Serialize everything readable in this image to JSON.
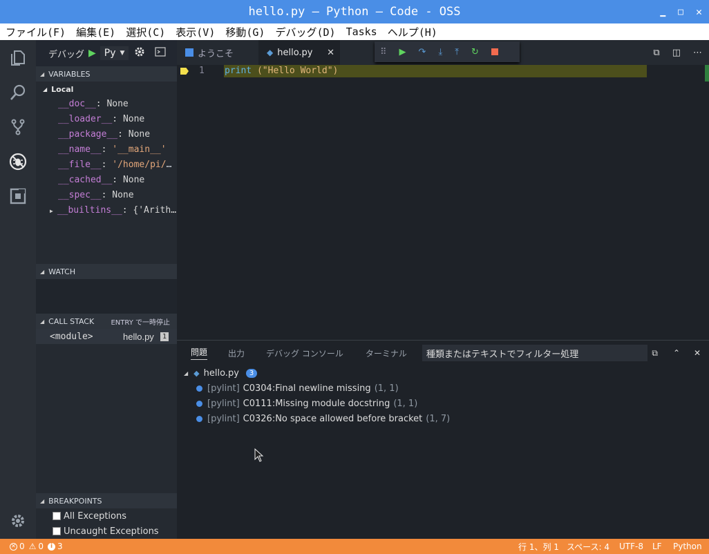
{
  "window": {
    "title": "hello.py — Python — Code - OSS"
  },
  "menu": [
    "ファイル(F)",
    "編集(E)",
    "選択(C)",
    "表示(V)",
    "移動(G)",
    "デバッグ(D)",
    "Tasks",
    "ヘルプ(H)"
  ],
  "debug": {
    "label": "デバッグ",
    "config": "Py"
  },
  "sections": {
    "variables": "VARIABLES",
    "local": "Local",
    "watch": "WATCH",
    "callstack": "CALL STACK",
    "callstack_status": "ENTRY で一時停止",
    "breakpoints": "BREAKPOINTS"
  },
  "variables": [
    {
      "name": "__doc__",
      "value": "None",
      "str": false
    },
    {
      "name": "__loader__",
      "value": "None",
      "str": false
    },
    {
      "name": "__package__",
      "value": "None",
      "str": false
    },
    {
      "name": "__name__",
      "value": "'__main__'",
      "str": true
    },
    {
      "name": "__file__",
      "value": "'/home/pi/P…",
      "str": true
    },
    {
      "name": "__cached__",
      "value": "None",
      "str": false
    },
    {
      "name": "__spec__",
      "value": "None",
      "str": false
    },
    {
      "name": "__builtins__",
      "value": "{'Arith…",
      "str": false
    }
  ],
  "callstack": {
    "frame": "<module>",
    "file": "hello.py",
    "line": "1"
  },
  "breakpoints": [
    "All Exceptions",
    "Uncaught Exceptions"
  ],
  "tabs": [
    {
      "label": "ようこそ"
    },
    {
      "label": "hello.py"
    }
  ],
  "code": {
    "line_no": "1",
    "fn": "print",
    "rest": " (\"Hello World\")"
  },
  "panel": {
    "tabs": [
      "問題",
      "出力",
      "デバッグ コンソール",
      "ターミナル"
    ],
    "filter_value": "種類またはテキストでフィルター処理",
    "file": "hello.py",
    "count": "3",
    "problems": [
      {
        "src": "[pylint]",
        "msg": "C0304:Final newline missing",
        "pos": "(1, 1)"
      },
      {
        "src": "[pylint]",
        "msg": "C0111:Missing module docstring",
        "pos": "(1, 1)"
      },
      {
        "src": "[pylint]",
        "msg": "C0326:No space allowed before bracket",
        "pos": "(1, 7)"
      }
    ]
  },
  "status": {
    "errors": "0",
    "warnings": "0",
    "infos": "3",
    "position": "行 1、列 1",
    "spaces": "スペース: 4",
    "encoding": "UTF-8",
    "eol": "LF",
    "language": "Python"
  },
  "colors": {
    "titlebar": "#4a8ee6",
    "statusbar": "#f28a3b",
    "highlight": "#4c4f1c",
    "debug_green": "#5fd35f",
    "stop_red": "#f26b4f"
  }
}
